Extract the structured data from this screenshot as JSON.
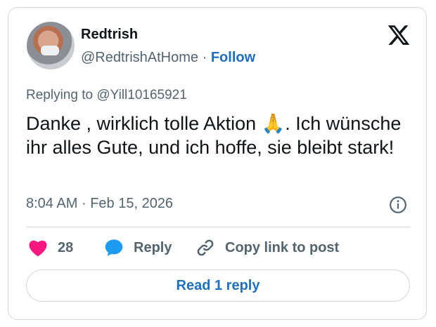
{
  "author": {
    "name": "Redtrish",
    "handle": "@RedtrishAtHome",
    "separator": "·",
    "follow_label": "Follow"
  },
  "brand_icon": "x-logo-icon",
  "tweet": {
    "replying_prefix": "Replying to",
    "replying_to": "@Yill10165921",
    "text_before_emoji": "Danke , wirklich tolle Aktion ",
    "emoji": "🙏",
    "text_after_emoji": ". Ich wünsche ihr alles Gute, und ich hoffe, sie bleibt stark!",
    "time": "8:04 AM",
    "separator": "·",
    "date": "Feb 15, 2026"
  },
  "actions": {
    "like_count": "28",
    "reply_label": "Reply",
    "copy_label": "Copy link to post"
  },
  "read_reply_label": "Read 1 reply",
  "colors": {
    "accent": "#1d6fc4",
    "like": "#f91880",
    "reply_icon": "#1d9bf0",
    "muted": "#536471",
    "border": "#cfd9de"
  }
}
